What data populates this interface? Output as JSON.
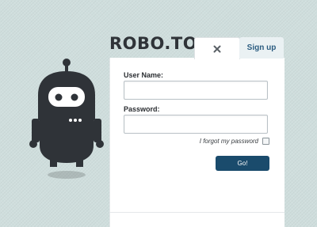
{
  "brand": {
    "logo_text": "ROBO.TO"
  },
  "tabs": {
    "close_icon": "close-icon",
    "signup_label": "Sign up"
  },
  "form": {
    "username_label": "User Name:",
    "username_value": "",
    "password_label": "Password:",
    "password_value": "",
    "forgot_label": "I forgot my password",
    "forgot_checked": false,
    "submit_label": "Go!"
  },
  "colors": {
    "background": "#cfdedd",
    "robot": "#2f3338",
    "button": "#1a4b6c",
    "signup_tab_bg": "#eaf1f3",
    "signup_text": "#2b5c80"
  },
  "icons": [
    "robot-mascot-icon",
    "close-icon",
    "checkbox-icon"
  ]
}
